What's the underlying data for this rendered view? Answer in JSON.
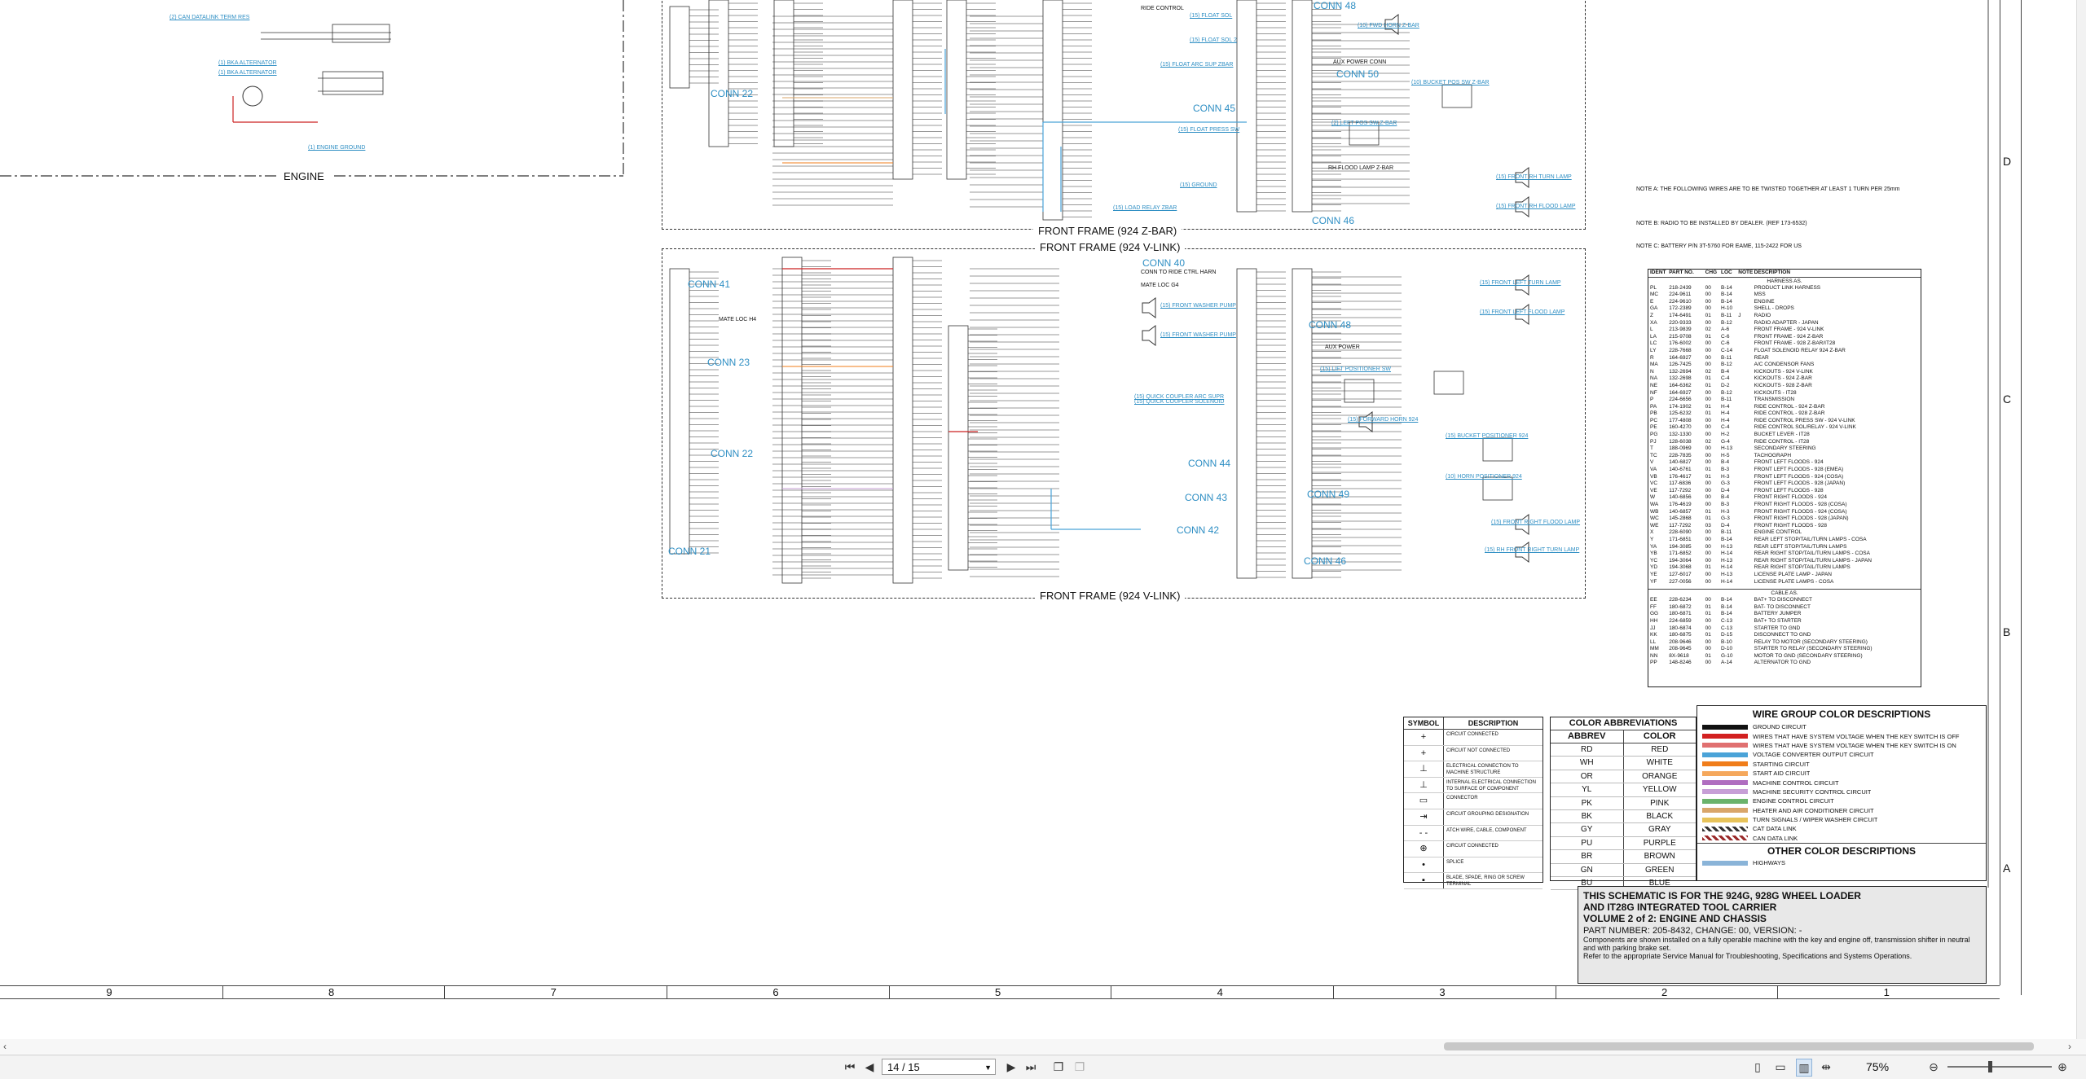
{
  "schematic": {
    "engine_label": "ENGINE",
    "frame_z_label": "FRONT FRAME (924 Z-BAR)",
    "frame_v_label_top": "FRONT FRAME (924 V-LINK)",
    "frame_v_label_bottom": "FRONT FRAME (924 V-LINK)",
    "connectors": [
      "CONN 22",
      "CONN 45",
      "CONN 48",
      "CONN 50",
      "CONN 46",
      "CONN 40",
      "CONN 41",
      "CONN 23",
      "CONN 48",
      "CONN 22",
      "CONN 44",
      "CONN 43",
      "CONN 42",
      "CONN 49",
      "CONN 21",
      "CONN 46"
    ],
    "callouts": [
      "(2) CAN DATALINK TERM RES",
      "(1) BKA ALTERNATOR",
      "(1) BKA ALTERNATOR",
      "(1) ENGINE GROUND",
      "(15) FLOAT SOL",
      "(15) FLOAT SOL 2",
      "(15) FLOAT ARC SUP ZBAR",
      "(15) FLOAT PRESS SW",
      "(15) GROUND",
      "(15) LOAD RELAY ZBAR",
      "(10) FWD HORN Z-BAR",
      "(2) LEFT POS SW Z-BAR",
      "(10) BUCKET POS SW Z-BAR",
      "(15) FRONT RH TURN LAMP",
      "(15) FRONT RH FLOOD LAMP",
      "(15) FRONT LEFT TURN LAMP",
      "(15) FRONT LEFT FLOOD LAMP",
      "(15) FRONT WASHER PUMP",
      "(15) FRONT WASHER PUMP",
      "(15) QUICK COUPLER ARC SUPR",
      "(15) QUICK COUPLER SOLENOID",
      "(15) LIFT POSITIONER SW",
      "(15) FORWARD HORN 924",
      "(15) BUCKET POSITIONER 924",
      "(10) HORN POSITIONER 924",
      "(15) FRONT RIGHT FLOOD LAMP",
      "(15) RH FRONT RIGHT TURN LAMP"
    ],
    "side_notes": [
      "RIDE CONTROL",
      "AUX POWER CONN",
      "RH FLOOD LAMP Z-BAR",
      "AUX POWER",
      "MATE LOC H4",
      "CONN TO RIDE CTRL HARN",
      "MATE LOC G4"
    ],
    "notes": [
      "NOTE A:   THE FOLLOWING WIRES ARE TO BE TWISTED TOGETHER AT LEAST 1 TURN PER 25mm",
      "NOTE B:   RADIO TO BE INSTALLED BY DEALER. (REF 173-6532)",
      "NOTE C:   BATTERY P/N 3T-5760 FOR EAME, 115-2422 FOR US"
    ],
    "zone_letters": [
      "D",
      "C",
      "B",
      "A"
    ],
    "column_numbers": [
      "9",
      "8",
      "7",
      "6",
      "5",
      "4",
      "3",
      "2",
      "1"
    ]
  },
  "harness_table": {
    "headers": [
      "IDENT",
      "PART NO.",
      "CHG",
      "LOC",
      "NOTE",
      "DESCRIPTION"
    ],
    "section_title": "HARNESS AS.",
    "rows": [
      [
        "PL",
        "218-2439",
        "00",
        "B-14",
        "",
        "PRODUCT LINK HARNESS"
      ],
      [
        "MC",
        "224-9611",
        "00",
        "B-14",
        "",
        "MSS"
      ],
      [
        "E",
        "224-9610",
        "00",
        "B-14",
        "",
        "ENGINE"
      ],
      [
        "GA",
        "172-2389",
        "00",
        "H-10",
        "",
        "SHELL - DROPS"
      ],
      [
        "Z",
        "174-6491",
        "01",
        "B-11",
        "J",
        "RADIO"
      ],
      [
        "XA",
        "220-9333",
        "00",
        "B-12",
        "",
        "RADIO ADAPTER - JAPAN"
      ],
      [
        "L",
        "213-9839",
        "02",
        "A-6",
        "",
        "FRONT FRAME - 924 V-LINK"
      ],
      [
        "LA",
        "215-9708",
        "01",
        "C-6",
        "",
        "FRONT FRAME - 924 Z-BAR"
      ],
      [
        "LC",
        "176-6002",
        "00",
        "C-6",
        "",
        "FRONT FRAME - 928 Z-BAR/IT28"
      ],
      [
        "LY",
        "228-7668",
        "00",
        "C-14",
        "",
        "FLOAT SOLENOID RELAY 924 Z-BAR"
      ],
      [
        "R",
        "164-6927",
        "00",
        "B-11",
        "",
        "REAR"
      ],
      [
        "MA",
        "126-7425",
        "00",
        "B-12",
        "",
        "A/C CONDENSOR FANS"
      ],
      [
        "N",
        "132-2694",
        "02",
        "B-4",
        "",
        "KICKOUTS - 924 V-LINK"
      ],
      [
        "NA",
        "132-2698",
        "01",
        "C-4",
        "",
        "KICKOUTS - 924 Z-BAR"
      ],
      [
        "NE",
        "164-6362",
        "01",
        "D-2",
        "",
        "KICKOUTS - 928 Z-BAR"
      ],
      [
        "NF",
        "164-6927",
        "00",
        "B-12",
        "",
        "KICKOUTS - IT28"
      ],
      [
        "P",
        "224-6656",
        "00",
        "B-11",
        "",
        "TRANSMISSION"
      ],
      [
        "PA",
        "174-1902",
        "01",
        "H-4",
        "",
        "RIDE CONTROL - 924 Z-BAR"
      ],
      [
        "PB",
        "125-6232",
        "01",
        "H-4",
        "",
        "RIDE CONTROL - 928 Z-BAR"
      ],
      [
        "PC",
        "177-4808",
        "00",
        "H-4",
        "",
        "RIDE CONTROL PRESS SW - 924 V-LINK"
      ],
      [
        "PE",
        "160-4270",
        "00",
        "C-4",
        "",
        "RIDE CONTROL SOL/RELAY - 924 V-LINK"
      ],
      [
        "PG",
        "132-1330",
        "00",
        "H-2",
        "",
        "BUCKET LEVER - IT28"
      ],
      [
        "PJ",
        "128-6038",
        "02",
        "G-4",
        "",
        "RIDE CONTROL - IT28"
      ],
      [
        "T",
        "188-0969",
        "00",
        "H-13",
        "",
        "SECONDARY STEERING"
      ],
      [
        "TC",
        "228-7835",
        "00",
        "H-5",
        "",
        "TACHOGRAPH"
      ],
      [
        "V",
        "140-6827",
        "00",
        "B-4",
        "",
        "FRONT LEFT FLOODS - 924"
      ],
      [
        "VA",
        "140-6761",
        "01",
        "B-3",
        "",
        "FRONT LEFT FLOODS - 928 (EMEA)"
      ],
      [
        "VB",
        "176-4617",
        "01",
        "H-3",
        "",
        "FRONT LEFT FLOODS - 924 (COSA)"
      ],
      [
        "VC",
        "117-6836",
        "00",
        "G-3",
        "",
        "FRONT LEFT FLOODS - 928 (JAPAN)"
      ],
      [
        "VE",
        "117-7292",
        "00",
        "D-4",
        "",
        "FRONT LEFT FLOODS - 928"
      ],
      [
        "W",
        "140-6856",
        "00",
        "B-4",
        "",
        "FRONT RIGHT FLOODS - 924"
      ],
      [
        "WA",
        "176-4619",
        "00",
        "B-3",
        "",
        "FRONT RIGHT FLOODS - 928 (COSA)"
      ],
      [
        "WB",
        "140-6857",
        "01",
        "H-3",
        "",
        "FRONT RIGHT FLOODS - 924 (COSA)"
      ],
      [
        "WC",
        "145-2868",
        "01",
        "G-3",
        "",
        "FRONT RIGHT FLOODS - 928 (JAPAN)"
      ],
      [
        "WE",
        "117-7292",
        "03",
        "D-4",
        "",
        "FRONT RIGHT FLOODS - 928"
      ],
      [
        "X",
        "228-6090",
        "00",
        "B-11",
        "",
        "ENGINE CONTROL"
      ],
      [
        "Y",
        "171-6851",
        "00",
        "B-14",
        "",
        "REAR LEFT STOP/TAIL/TURN LAMPS - COSA"
      ],
      [
        "YA",
        "194-3085",
        "00",
        "H-13",
        "",
        "REAR LEFT STOP/TAIL/TURN LAMPS"
      ],
      [
        "YB",
        "171-6852",
        "00",
        "H-14",
        "",
        "REAR RIGHT STOP/TAIL/TURN LAMPS - COSA"
      ],
      [
        "YC",
        "194-3064",
        "00",
        "H-13",
        "",
        "REAR RIGHT STOP/TAIL/TURN LAMPS - JAPAN"
      ],
      [
        "YD",
        "194-3068",
        "01",
        "H-14",
        "",
        "REAR RIGHT STOP/TAIL/TURN LAMPS"
      ],
      [
        "YE",
        "127-6017",
        "00",
        "H-13",
        "",
        "LICENSE PLATE LAMP - JAPAN"
      ],
      [
        "YF",
        "227-0056",
        "00",
        "H-14",
        "",
        "LICENSE PLATE LAMPS - COSA"
      ]
    ],
    "cable_title": "CABLE AS.",
    "cable_rows": [
      [
        "EE",
        "228-6234",
        "00",
        "B-14",
        "",
        "BAT+ TO DISCONNECT"
      ],
      [
        "FF",
        "180-6872",
        "01",
        "B-14",
        "",
        "BAT- TO DISCONNECT"
      ],
      [
        "GG",
        "180-6871",
        "01",
        "B-14",
        "",
        "BATTERY JUMPER"
      ],
      [
        "HH",
        "224-6859",
        "00",
        "C-13",
        "",
        "BAT+ TO STARTER"
      ],
      [
        "JJ",
        "180-6874",
        "00",
        "C-13",
        "",
        "STARTER TO GND"
      ],
      [
        "KK",
        "180-6875",
        "01",
        "D-15",
        "",
        "DISCONNECT TO GND"
      ],
      [
        "LL",
        "208-9646",
        "00",
        "B-10",
        "",
        "RELAY TO MOTOR (SECONDARY STEERING)"
      ],
      [
        "MM",
        "208-9645",
        "00",
        "D-10",
        "",
        "STARTER TO RELAY (SECONDARY STEERING)"
      ],
      [
        "NN",
        "8X-9618",
        "01",
        "G-10",
        "",
        "MOTOR TO GND (SECONDARY STEERING)"
      ],
      [
        "PP",
        "148-8246",
        "00",
        "A-14",
        "",
        "ALTERNATOR TO GND"
      ]
    ]
  },
  "symbol_table": {
    "headers": [
      "SYMBOL",
      "DESCRIPTION"
    ],
    "rows": [
      [
        "+",
        "CIRCUIT CONNECTED"
      ],
      [
        "+",
        "CIRCUIT NOT CONNECTED"
      ],
      [
        "⊥",
        "ELECTRICAL CONNECTION TO MACHINE STRUCTURE"
      ],
      [
        "⊥",
        "INTERNAL ELECTRICAL CONNECTION TO SURFACE OF COMPONENT"
      ],
      [
        "▭",
        "CONNECTOR"
      ],
      [
        "⇥",
        "CIRCUIT GROUPING DESIGNATION"
      ],
      [
        "- -",
        "ATCH WIRE, CABLE, COMPONENT"
      ],
      [
        "⊕",
        "CIRCUIT CONNECTED"
      ],
      [
        "•",
        "SPLICE"
      ],
      [
        "▪",
        "BLADE, SPADE, RING OR SCREW TERMINAL"
      ]
    ]
  },
  "color_abbrev": {
    "title": "COLOR ABBREVIATIONS",
    "headers": [
      "ABBREV",
      "COLOR"
    ],
    "rows": [
      [
        "RD",
        "RED"
      ],
      [
        "WH",
        "WHITE"
      ],
      [
        "OR",
        "ORANGE"
      ],
      [
        "YL",
        "YELLOW"
      ],
      [
        "PK",
        "PINK"
      ],
      [
        "BK",
        "BLACK"
      ],
      [
        "GY",
        "GRAY"
      ],
      [
        "PU",
        "PURPLE"
      ],
      [
        "BR",
        "BROWN"
      ],
      [
        "GN",
        "GREEN"
      ],
      [
        "BU",
        "BLUE"
      ]
    ]
  },
  "wire_groups": {
    "title": "WIRE GROUP COLOR DESCRIPTIONS",
    "rows": [
      {
        "color": "#111111",
        "label": "GROUND CIRCUIT"
      },
      {
        "color": "#d22020",
        "label": "WIRES THAT HAVE SYSTEM VOLTAGE WHEN THE KEY SWITCH IS OFF"
      },
      {
        "color": "#e07070",
        "label": "WIRES THAT HAVE SYSTEM VOLTAGE WHEN THE KEY SWITCH IS ON"
      },
      {
        "color": "#4aa3d8",
        "label": "VOLTAGE CONVERTER OUTPUT CIRCUIT"
      },
      {
        "color": "#f07d1a",
        "label": "STARTING CIRCUIT"
      },
      {
        "color": "#f5a85c",
        "label": "START AID CIRCUIT"
      },
      {
        "color": "#b06ec0",
        "label": "MACHINE CONTROL CIRCUIT"
      },
      {
        "color": "#c79fd6",
        "label": "MACHINE SECURITY CONTROL CIRCUIT"
      },
      {
        "color": "#6bb36b",
        "label": "ENGINE CONTROL CIRCUIT"
      },
      {
        "color": "#d9a66a",
        "label": "HEATER AND AIR CONDITIONER CIRCUIT"
      },
      {
        "color": "#e7c35a",
        "label": "TURN SIGNALS / WIPER WASHER CIRCUIT"
      },
      {
        "color": "#333333",
        "label": "CAT DATA LINK"
      },
      {
        "color": "#9a2a2a",
        "label": "CAN DATA LINK"
      }
    ],
    "other_title": "OTHER COLOR DESCRIPTIONS",
    "other_rows": [
      {
        "color": "#8ab4d8",
        "label": "HIGHWAYS"
      }
    ]
  },
  "title_block": {
    "line1": "THIS SCHEMATIC IS FOR THE 924G, 928G WHEEL LOADER",
    "line2": "AND IT28G INTEGRATED TOOL CARRIER",
    "line3": "VOLUME 2 of 2: ENGINE AND CHASSIS",
    "line4": "PART NUMBER: 205-8432, CHANGE: 00, VERSION: -",
    "line5": "Components are shown installed on a fully operable machine with the key and engine off, transmission shifter in neutral and with parking brake set.",
    "line6": "Refer to the appropriate Service Manual for Troubleshooting, Specifications and Systems Operations."
  },
  "viewer": {
    "page_value": "14 / 15",
    "zoom_value": "75%"
  }
}
